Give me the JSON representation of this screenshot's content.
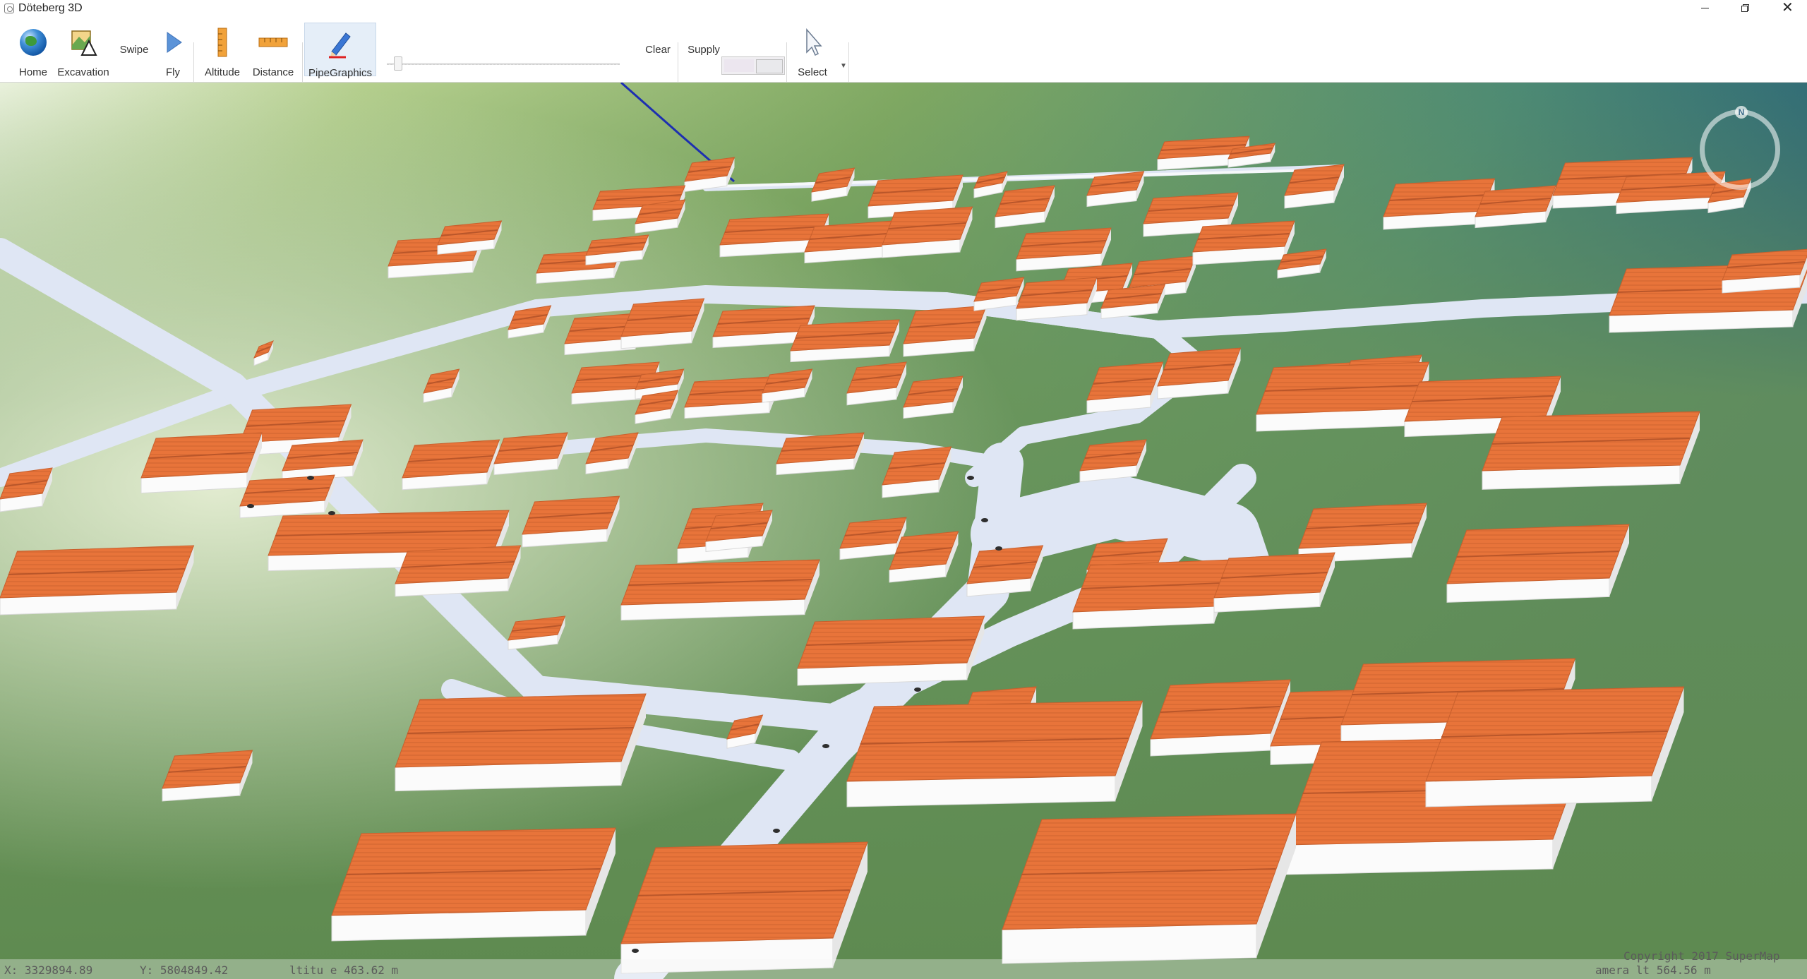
{
  "window": {
    "title": "Döteberg 3D"
  },
  "toolbar": {
    "home": "Home",
    "excavation": "Excavation",
    "swipe": "Swipe",
    "fly": "Fly",
    "altitude": "Altitude",
    "distance": "Distance",
    "pipe_graphics": "PipeGraphics",
    "clear": "Clear",
    "supply": "Supply",
    "select": "Select"
  },
  "icons": [
    "globe-icon",
    "excavation-icon",
    "fly-arrow-icon",
    "ruler-icon",
    "distance-ruler-icon",
    "pencil-icon",
    "cursor-icon",
    "chevron-down-icon",
    "minimize-icon",
    "restore-icon",
    "close-icon",
    "compass-icon"
  ],
  "colors": {
    "roof": "#e8743a",
    "wall": "#fbfbfb",
    "road": "#dfe6f4",
    "grass": "#6e9a5c",
    "accent": "#2a66c9"
  },
  "compass": {
    "label": "N"
  },
  "status": {
    "x": "X: 3329894.89",
    "y": "Y: 5804849.42",
    "alt": "ltitu  e  463.62 m",
    "camera": "amera  lt  564.56 m",
    "copyright": "Copyright 2017 SuperMap"
  }
}
